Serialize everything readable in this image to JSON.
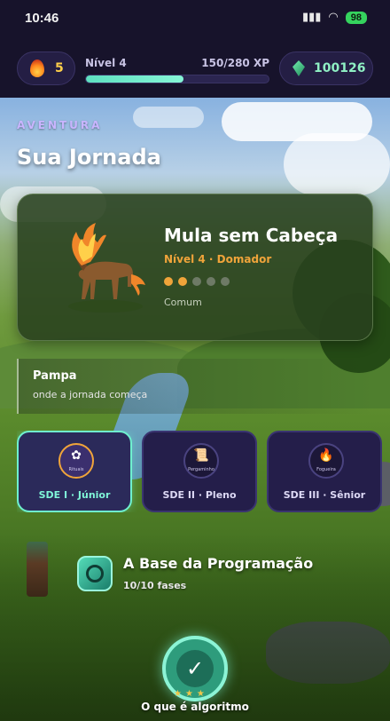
{
  "status_bar": {
    "time": "10:46",
    "battery": "98"
  },
  "header": {
    "streak": "5",
    "level_label": "Nível 4",
    "xp_label": "150/280 XP",
    "xp_progress": 0.536,
    "gems": "100126"
  },
  "journey": {
    "eyebrow": "AVENTURA",
    "title": "Sua Jornada"
  },
  "creature": {
    "name": "Mula sem Cabeça",
    "level": "Nível 4 · Domador",
    "dots_filled": 2,
    "dots_total": 5,
    "rarity": "Comum",
    "icon": "flaming-mule-icon"
  },
  "region": {
    "name": "Pampa",
    "subtitle": "onde a jornada começa"
  },
  "tiers": [
    {
      "label": "SDE I · Júnior",
      "icon_caption": "Rituais",
      "icon": "lotus-icon",
      "active": true
    },
    {
      "label": "SDE II · Pleno",
      "icon_caption": "Pergaminho",
      "icon": "scroll-icon",
      "active": false
    },
    {
      "label": "SDE III · Sênior",
      "icon_caption": "Fogueira",
      "icon": "campfire-icon",
      "active": false
    }
  ],
  "module": {
    "title": "A Base da Programação",
    "progress": "10/10 fases"
  },
  "lesson_node": {
    "label": "O que é algoritmo",
    "icon": "check-icon"
  },
  "colors": {
    "accent_mint": "#6ff0cf",
    "accent_orange": "#f0a43a",
    "header_bg": "#17132b"
  }
}
